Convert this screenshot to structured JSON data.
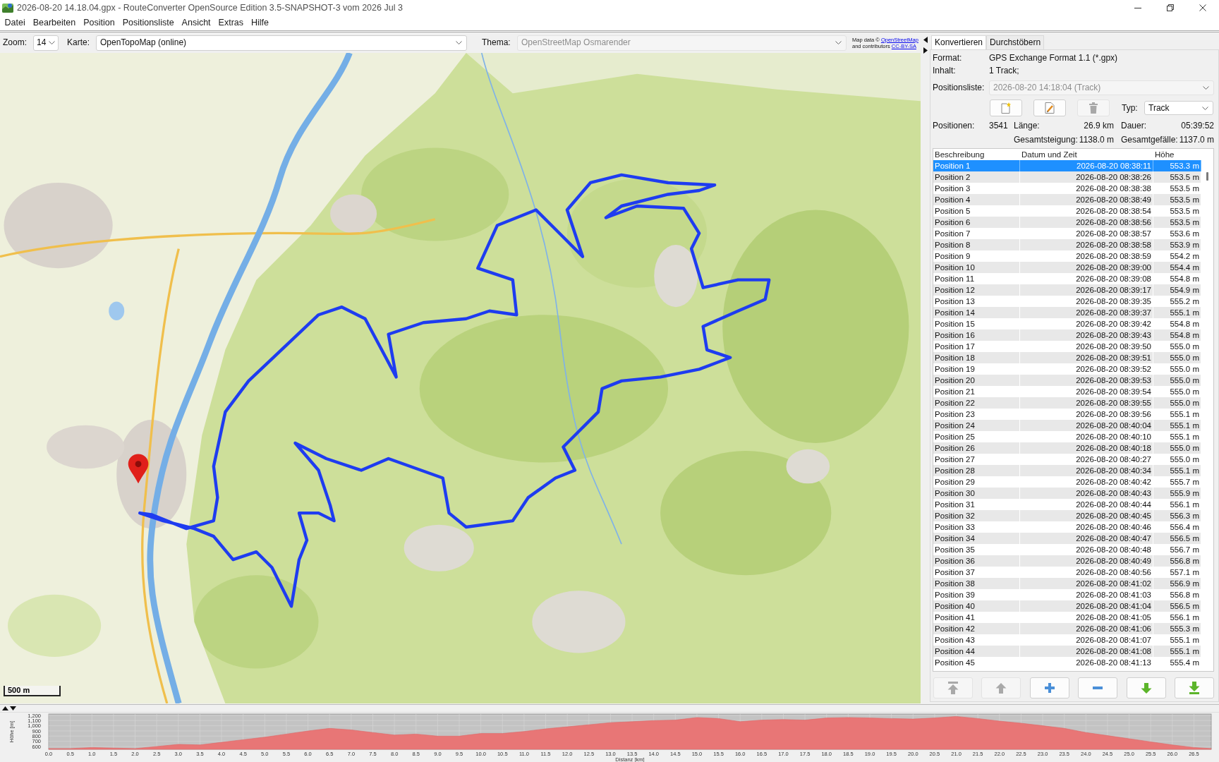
{
  "window": {
    "title": "2026-08-20 14.18.04.gpx - RouteConverter OpenSource Edition 3.5-SNAPSHOT-3 vom 2026 Jul 3"
  },
  "menu": [
    "Datei",
    "Bearbeiten",
    "Position",
    "Positionsliste",
    "Ansicht",
    "Extras",
    "Hilfe"
  ],
  "map_toolbar": {
    "zoom": {
      "label": "Zoom:",
      "value": "14",
      "disabled": false
    },
    "map": {
      "label": "Karte:",
      "value": "OpenTopoMap (online)",
      "disabled": false
    },
    "theme": {
      "label": "Thema:",
      "value": "OpenStreetMap Osmarender",
      "disabled": true
    }
  },
  "map_attribution": [
    {
      "text": "Map data ©",
      "link": "OpenStreetMap"
    },
    {
      "text": "and contributors",
      "link": "CC-BY-SA"
    }
  ],
  "map": {
    "scale": "500 m"
  },
  "tabs": [
    {
      "label": "Konvertieren",
      "selected": true
    },
    {
      "label": "Durchstöbern",
      "selected": false
    }
  ],
  "converter": {
    "format": {
      "label": "Format:",
      "value": "GPS Exchange Format 1.1 (*.gpx)"
    },
    "content": {
      "label": "Inhalt:",
      "value": "1 Track;"
    },
    "position_list": {
      "label": "Positionsliste:",
      "value": "2026-08-20 14:18:04 (Track)",
      "disabled": true
    },
    "list_buttons": [
      {
        "disabled": false
      },
      {
        "disabled": false
      },
      {
        "disabled": true
      }
    ],
    "type": {
      "label": "Typ:",
      "value": "Track",
      "disabled": false
    },
    "stats": {
      "positions": {
        "label": "Positionen:",
        "value": "3541"
      },
      "length": {
        "label": "Länge:",
        "value": "26.9 km"
      },
      "duration": {
        "label": "Dauer:",
        "value": "05:39:52"
      },
      "ascent": {
        "label": "Gesamtsteigung:",
        "value": "1138.0 m"
      },
      "descent": {
        "label": "Gesamtgefälle:",
        "value": "1137.0 m"
      }
    }
  },
  "table": {
    "columns": [
      "Beschreibung",
      "Datum und Zeit",
      "Höhe"
    ],
    "rows": [
      {
        "description": "Position 1",
        "datetime": "2026-08-20 08:38:11",
        "elevation": "553.3 m",
        "selected": true
      },
      {
        "description": "Position 2",
        "datetime": "2026-08-20 08:38:26",
        "elevation": "553.5 m",
        "selected": false
      },
      {
        "description": "Position 3",
        "datetime": "2026-08-20 08:38:38",
        "elevation": "553.5 m",
        "selected": false
      },
      {
        "description": "Position 4",
        "datetime": "2026-08-20 08:38:49",
        "elevation": "553.5 m",
        "selected": false
      },
      {
        "description": "Position 5",
        "datetime": "2026-08-20 08:38:54",
        "elevation": "553.5 m",
        "selected": false
      },
      {
        "description": "Position 6",
        "datetime": "2026-08-20 08:38:56",
        "elevation": "553.5 m",
        "selected": false
      },
      {
        "description": "Position 7",
        "datetime": "2026-08-20 08:38:57",
        "elevation": "553.6 m",
        "selected": false
      },
      {
        "description": "Position 8",
        "datetime": "2026-08-20 08:38:58",
        "elevation": "553.9 m",
        "selected": false
      },
      {
        "description": "Position 9",
        "datetime": "2026-08-20 08:38:59",
        "elevation": "554.2 m",
        "selected": false
      },
      {
        "description": "Position 10",
        "datetime": "2026-08-20 08:39:00",
        "elevation": "554.4 m",
        "selected": false
      },
      {
        "description": "Position 11",
        "datetime": "2026-08-20 08:39:08",
        "elevation": "554.8 m",
        "selected": false
      },
      {
        "description": "Position 12",
        "datetime": "2026-08-20 08:39:17",
        "elevation": "554.9 m",
        "selected": false
      },
      {
        "description": "Position 13",
        "datetime": "2026-08-20 08:39:35",
        "elevation": "555.2 m",
        "selected": false
      },
      {
        "description": "Position 14",
        "datetime": "2026-08-20 08:39:37",
        "elevation": "555.1 m",
        "selected": false
      },
      {
        "description": "Position 15",
        "datetime": "2026-08-20 08:39:42",
        "elevation": "554.8 m",
        "selected": false
      },
      {
        "description": "Position 16",
        "datetime": "2026-08-20 08:39:43",
        "elevation": "554.8 m",
        "selected": false
      },
      {
        "description": "Position 17",
        "datetime": "2026-08-20 08:39:50",
        "elevation": "555.0 m",
        "selected": false
      },
      {
        "description": "Position 18",
        "datetime": "2026-08-20 08:39:51",
        "elevation": "555.0 m",
        "selected": false
      },
      {
        "description": "Position 19",
        "datetime": "2026-08-20 08:39:52",
        "elevation": "555.0 m",
        "selected": false
      },
      {
        "description": "Position 20",
        "datetime": "2026-08-20 08:39:53",
        "elevation": "555.0 m",
        "selected": false
      },
      {
        "description": "Position 21",
        "datetime": "2026-08-20 08:39:54",
        "elevation": "555.0 m",
        "selected": false
      },
      {
        "description": "Position 22",
        "datetime": "2026-08-20 08:39:55",
        "elevation": "555.0 m",
        "selected": false
      },
      {
        "description": "Position 23",
        "datetime": "2026-08-20 08:39:56",
        "elevation": "555.1 m",
        "selected": false
      },
      {
        "description": "Position 24",
        "datetime": "2026-08-20 08:40:04",
        "elevation": "555.1 m",
        "selected": false
      },
      {
        "description": "Position 25",
        "datetime": "2026-08-20 08:40:10",
        "elevation": "555.1 m",
        "selected": false
      },
      {
        "description": "Position 26",
        "datetime": "2026-08-20 08:40:18",
        "elevation": "555.0 m",
        "selected": false
      },
      {
        "description": "Position 27",
        "datetime": "2026-08-20 08:40:27",
        "elevation": "555.0 m",
        "selected": false
      },
      {
        "description": "Position 28",
        "datetime": "2026-08-20 08:40:34",
        "elevation": "555.1 m",
        "selected": false
      },
      {
        "description": "Position 29",
        "datetime": "2026-08-20 08:40:42",
        "elevation": "555.7 m",
        "selected": false
      },
      {
        "description": "Position 30",
        "datetime": "2026-08-20 08:40:43",
        "elevation": "555.9 m",
        "selected": false
      },
      {
        "description": "Position 31",
        "datetime": "2026-08-20 08:40:44",
        "elevation": "556.1 m",
        "selected": false
      },
      {
        "description": "Position 32",
        "datetime": "2026-08-20 08:40:45",
        "elevation": "556.3 m",
        "selected": false
      },
      {
        "description": "Position 33",
        "datetime": "2026-08-20 08:40:46",
        "elevation": "556.4 m",
        "selected": false
      },
      {
        "description": "Position 34",
        "datetime": "2026-08-20 08:40:47",
        "elevation": "556.5 m",
        "selected": false
      },
      {
        "description": "Position 35",
        "datetime": "2026-08-20 08:40:48",
        "elevation": "556.7 m",
        "selected": false
      },
      {
        "description": "Position 36",
        "datetime": "2026-08-20 08:40:49",
        "elevation": "556.8 m",
        "selected": false
      },
      {
        "description": "Position 37",
        "datetime": "2026-08-20 08:40:56",
        "elevation": "557.1 m",
        "selected": false
      },
      {
        "description": "Position 38",
        "datetime": "2026-08-20 08:41:02",
        "elevation": "556.9 m",
        "selected": false
      },
      {
        "description": "Position 39",
        "datetime": "2026-08-20 08:41:03",
        "elevation": "556.8 m",
        "selected": false
      },
      {
        "description": "Position 40",
        "datetime": "2026-08-20 08:41:04",
        "elevation": "556.5 m",
        "selected": false
      },
      {
        "description": "Position 41",
        "datetime": "2026-08-20 08:41:05",
        "elevation": "556.1 m",
        "selected": false
      },
      {
        "description": "Position 42",
        "datetime": "2026-08-20 08:41:06",
        "elevation": "555.3 m",
        "selected": false
      },
      {
        "description": "Position 43",
        "datetime": "2026-08-20 08:41:07",
        "elevation": "555.1 m",
        "selected": false
      },
      {
        "description": "Position 44",
        "datetime": "2026-08-20 08:41:08",
        "elevation": "555.1 m",
        "selected": false
      },
      {
        "description": "Position 45",
        "datetime": "2026-08-20 08:41:13",
        "elevation": "555.4 m",
        "selected": false
      }
    ]
  },
  "position_buttons": [
    {
      "disabled": true
    },
    {
      "disabled": true
    },
    {
      "disabled": false
    },
    {
      "disabled": false
    },
    {
      "disabled": false
    },
    {
      "disabled": false
    }
  ],
  "elevation_profile": {
    "chart_data": {
      "type": "area",
      "xlabel": "Distanz [km]",
      "ylabel": "Höhe [m]",
      "grid": true,
      "x": [
        0,
        0.5,
        1,
        1.5,
        2,
        2.5,
        3,
        3.5,
        4,
        4.5,
        5,
        5.5,
        6,
        6.5,
        7,
        7.5,
        8,
        8.5,
        9,
        9.5,
        10,
        10.5,
        11,
        11.5,
        12,
        12.5,
        13,
        13.5,
        14,
        14.5,
        15,
        15.5,
        16,
        16.5,
        17,
        17.5,
        18,
        18.5,
        19,
        19.5,
        20,
        20.5,
        21,
        21.5,
        22,
        22.5,
        23,
        23.5,
        24,
        24.5,
        25,
        25.5,
        26,
        26.5,
        26.9
      ],
      "values": [
        560,
        560,
        580,
        570,
        560,
        600,
        640,
        630,
        680,
        730,
        780,
        840,
        900,
        950,
        920,
        870,
        820,
        840,
        800,
        800,
        850,
        850,
        890,
        940,
        980,
        1020,
        1060,
        1080,
        1100,
        1110,
        1160,
        1140,
        1080,
        1110,
        1120,
        1110,
        1150,
        1160,
        1150,
        1140,
        1130,
        1150,
        1180,
        1140,
        1090,
        1050,
        1000,
        950,
        870,
        810,
        750,
        690,
        630,
        580,
        560
      ],
      "xlim": [
        0,
        26.9
      ],
      "ylim": [
        545,
        1227
      ],
      "xticks": [
        {
          "value": 0,
          "label": "0.0"
        },
        {
          "value": 0.5,
          "label": "0.5"
        },
        {
          "value": 1,
          "label": "1.0"
        },
        {
          "value": 1.5,
          "label": "1.5"
        },
        {
          "value": 2,
          "label": "2.0"
        },
        {
          "value": 2.5,
          "label": "2.5"
        },
        {
          "value": 3,
          "label": "3.0"
        },
        {
          "value": 3.5,
          "label": "3.5"
        },
        {
          "value": 4,
          "label": "4.0"
        },
        {
          "value": 4.5,
          "label": "4.5"
        },
        {
          "value": 5,
          "label": "5.0"
        },
        {
          "value": 5.5,
          "label": "5.5"
        },
        {
          "value": 6,
          "label": "6.0"
        },
        {
          "value": 6.5,
          "label": "6.5"
        },
        {
          "value": 7,
          "label": "7.0"
        },
        {
          "value": 7.5,
          "label": "7.5"
        },
        {
          "value": 8,
          "label": "8.0"
        },
        {
          "value": 8.5,
          "label": "8.5"
        },
        {
          "value": 9,
          "label": "9.0"
        },
        {
          "value": 9.5,
          "label": "9.5"
        },
        {
          "value": 10,
          "label": "10.0"
        },
        {
          "value": 10.5,
          "label": "10.5"
        },
        {
          "value": 11,
          "label": "11.0"
        },
        {
          "value": 11.5,
          "label": "11.5"
        },
        {
          "value": 12,
          "label": "12.0"
        },
        {
          "value": 12.5,
          "label": "12.5"
        },
        {
          "value": 13,
          "label": "13.0"
        },
        {
          "value": 13.5,
          "label": "13.5"
        },
        {
          "value": 14,
          "label": "14.0"
        },
        {
          "value": 14.5,
          "label": "14.5"
        },
        {
          "value": 15,
          "label": "15.0"
        },
        {
          "value": 15.5,
          "label": "15.5"
        },
        {
          "value": 16,
          "label": "16.0"
        },
        {
          "value": 16.5,
          "label": "16.5"
        },
        {
          "value": 17,
          "label": "17.0"
        },
        {
          "value": 17.5,
          "label": "17.5"
        },
        {
          "value": 18,
          "label": "18.0"
        },
        {
          "value": 18.5,
          "label": "18.5"
        },
        {
          "value": 19,
          "label": "19.0"
        },
        {
          "value": 19.5,
          "label": "19.5"
        },
        {
          "value": 20,
          "label": "20.0"
        },
        {
          "value": 20.5,
          "label": "20.5"
        },
        {
          "value": 21,
          "label": "21.0"
        },
        {
          "value": 21.5,
          "label": "21.5"
        },
        {
          "value": 22,
          "label": "22.0"
        },
        {
          "value": 22.5,
          "label": "22.5"
        },
        {
          "value": 23,
          "label": "23.0"
        },
        {
          "value": 23.5,
          "label": "23.5"
        },
        {
          "value": 24,
          "label": "24.0"
        },
        {
          "value": 24.5,
          "label": "24.5"
        },
        {
          "value": 25,
          "label": "25.0"
        },
        {
          "value": 25.5,
          "label": "25.5"
        },
        {
          "value": 26,
          "label": "26.0"
        },
        {
          "value": 26.5,
          "label": "26.5"
        }
      ],
      "yticks": [
        {
          "value": 600,
          "label": "600"
        },
        {
          "value": 700,
          "label": "700"
        },
        {
          "value": 800,
          "label": "800"
        },
        {
          "value": 900,
          "label": "900"
        },
        {
          "value": 1000,
          "label": "1,000"
        },
        {
          "value": 1100,
          "label": "1,100"
        },
        {
          "value": 1200,
          "label": "1,200"
        }
      ]
    }
  }
}
